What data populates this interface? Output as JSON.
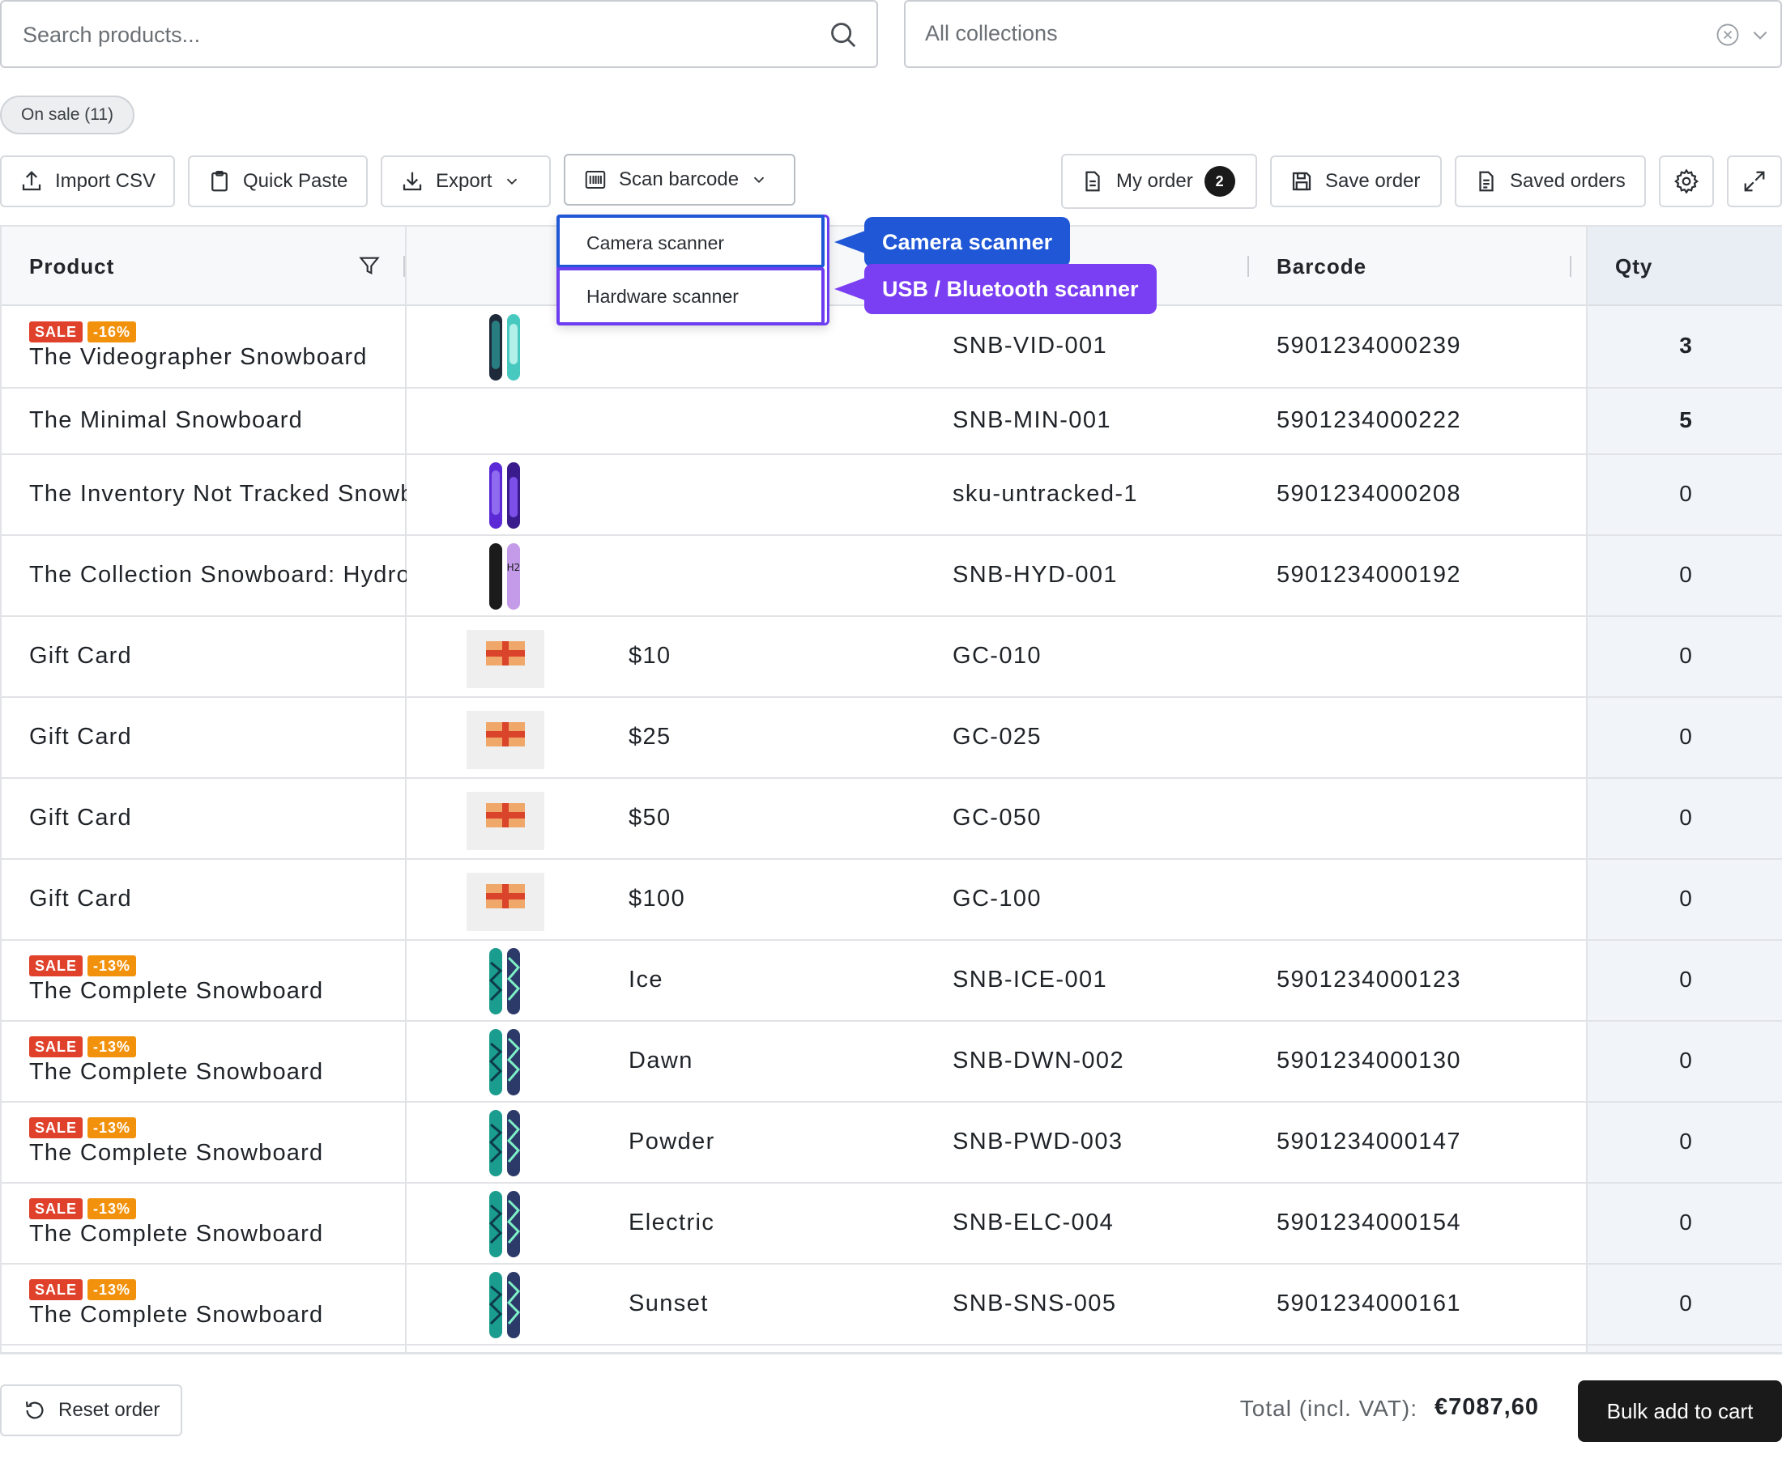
{
  "search": {
    "placeholder": "Search products..."
  },
  "collections": {
    "selected": "All collections"
  },
  "filter_chip": {
    "label": "On sale (11)"
  },
  "toolbar": {
    "import_csv": "Import CSV",
    "quick_paste": "Quick Paste",
    "export": "Export",
    "scan_barcode": "Scan barcode",
    "my_order": "My order",
    "my_order_count": "2",
    "save_order": "Save order",
    "saved_orders": "Saved orders"
  },
  "scan_menu": {
    "items": [
      "Camera scanner",
      "Hardware scanner"
    ],
    "callouts": [
      "Camera scanner",
      "USB / Bluetooth scanner"
    ]
  },
  "table": {
    "headers": {
      "product": "Product",
      "barcode": "Barcode",
      "qty": "Qty"
    },
    "rows": [
      {
        "badges": [
          "SALE",
          "-16%"
        ],
        "product": "The Videographer Snowboard",
        "variant": "",
        "sku": "SNB-VID-001",
        "barcode": "5901234000239",
        "qty": "3",
        "thumb": "videographer"
      },
      {
        "badges": [],
        "product": "The Minimal Snowboard",
        "variant": "",
        "sku": "SNB-MIN-001",
        "barcode": "5901234000222",
        "qty": "5",
        "thumb": ""
      },
      {
        "badges": [],
        "product": "The Inventory Not Tracked Snowboard",
        "variant": "",
        "sku": "sku-untracked-1",
        "barcode": "5901234000208",
        "qty": "0",
        "thumb": "purple"
      },
      {
        "badges": [],
        "product": "The Collection Snowboard: Hydrogen",
        "variant": "",
        "sku": "SNB-HYD-001",
        "barcode": "5901234000192",
        "qty": "0",
        "thumb": "hydrogen"
      },
      {
        "badges": [],
        "product": "Gift Card",
        "variant": "$10",
        "sku": "GC-010",
        "barcode": "",
        "qty": "0",
        "thumb": "gift"
      },
      {
        "badges": [],
        "product": "Gift Card",
        "variant": "$25",
        "sku": "GC-025",
        "barcode": "",
        "qty": "0",
        "thumb": "gift"
      },
      {
        "badges": [],
        "product": "Gift Card",
        "variant": "$50",
        "sku": "GC-050",
        "barcode": "",
        "qty": "0",
        "thumb": "gift"
      },
      {
        "badges": [],
        "product": "Gift Card",
        "variant": "$100",
        "sku": "GC-100",
        "barcode": "",
        "qty": "0",
        "thumb": "gift"
      },
      {
        "badges": [
          "SALE",
          "-13%"
        ],
        "product": "The Complete Snowboard",
        "variant": "Ice",
        "sku": "SNB-ICE-001",
        "barcode": "5901234000123",
        "qty": "0",
        "thumb": "complete"
      },
      {
        "badges": [
          "SALE",
          "-13%"
        ],
        "product": "The Complete Snowboard",
        "variant": "Dawn",
        "sku": "SNB-DWN-002",
        "barcode": "5901234000130",
        "qty": "0",
        "thumb": "complete"
      },
      {
        "badges": [
          "SALE",
          "-13%"
        ],
        "product": "The Complete Snowboard",
        "variant": "Powder",
        "sku": "SNB-PWD-003",
        "barcode": "5901234000147",
        "qty": "0",
        "thumb": "complete"
      },
      {
        "badges": [
          "SALE",
          "-13%"
        ],
        "product": "The Complete Snowboard",
        "variant": "Electric",
        "sku": "SNB-ELC-004",
        "barcode": "5901234000154",
        "qty": "0",
        "thumb": "complete"
      },
      {
        "badges": [
          "SALE",
          "-13%"
        ],
        "product": "The Complete Snowboard",
        "variant": "Sunset",
        "sku": "SNB-SNS-005",
        "barcode": "5901234000161",
        "qty": "0",
        "thumb": "complete"
      }
    ]
  },
  "footer": {
    "reset": "Reset order",
    "total_label": "Total (incl. VAT):",
    "total_value": "€7087,60",
    "bulk_add": "Bulk add to cart"
  },
  "colors": {
    "sale_badge": "#e0412b",
    "discount_badge": "#f2920c",
    "camera_callout": "#1f57d6",
    "hardware_callout": "#7a3ff2",
    "primary_button": "#1a1a1a"
  }
}
